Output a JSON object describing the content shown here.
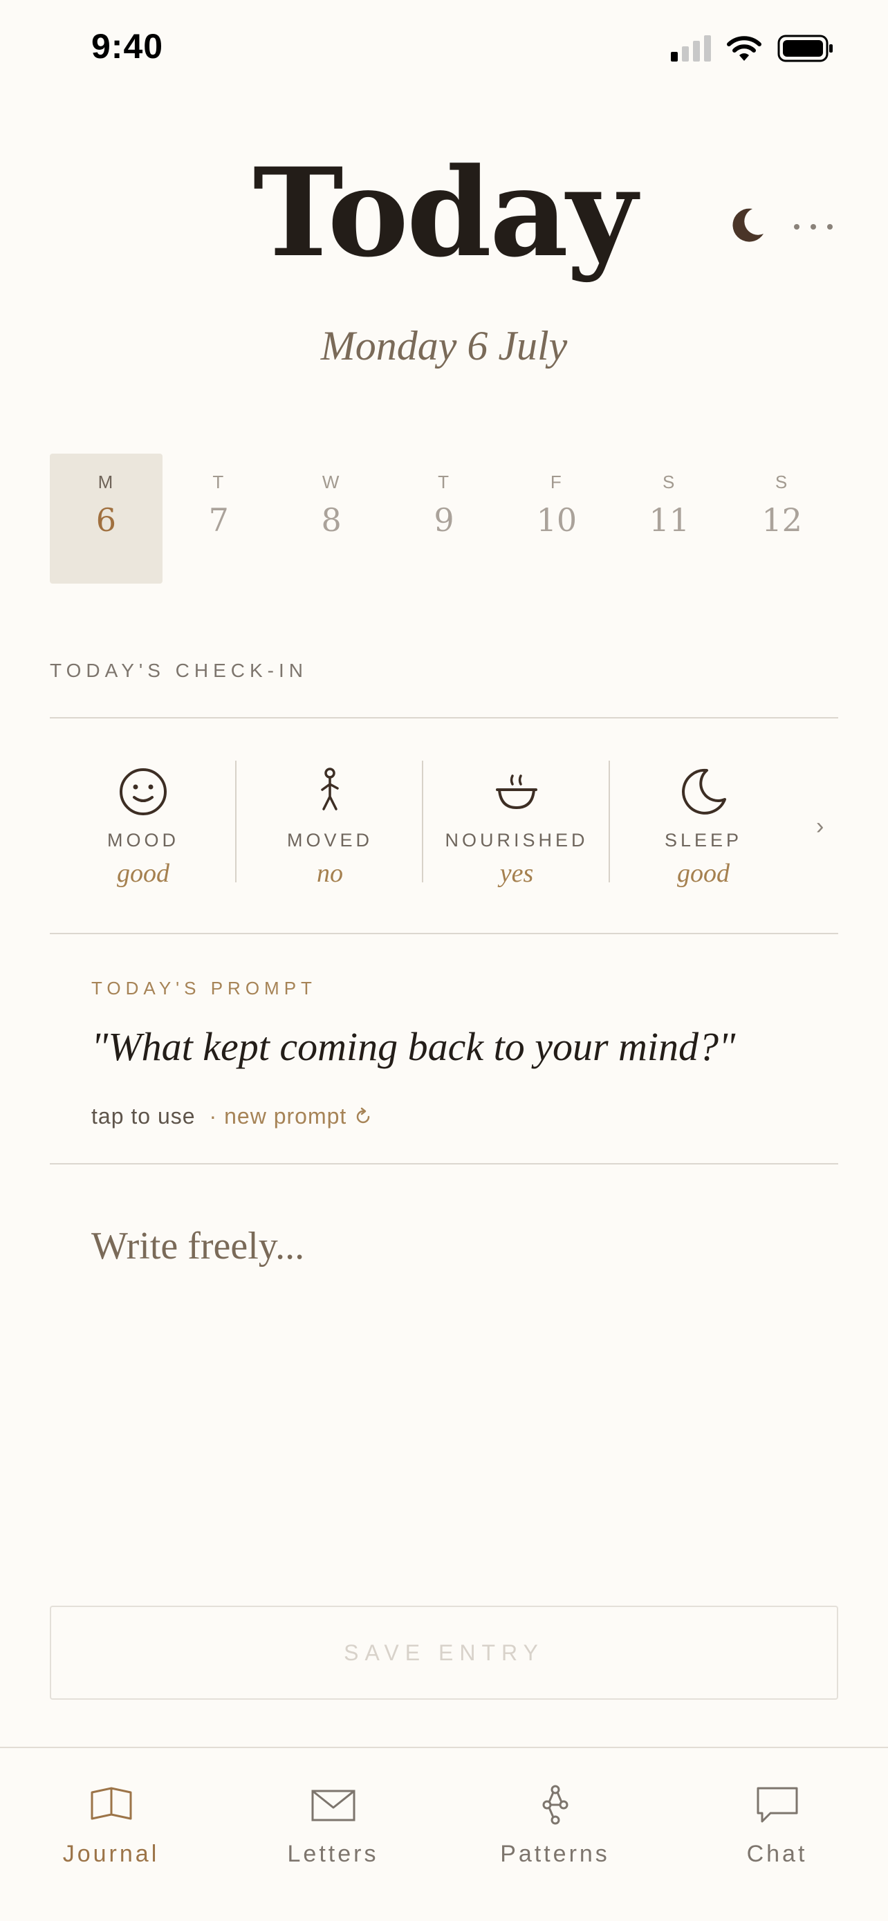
{
  "status_bar": {
    "time": "9:40"
  },
  "header": {
    "title": "Today",
    "date": "Monday 6 July"
  },
  "week": [
    {
      "dow": "M",
      "num": "6",
      "selected": true
    },
    {
      "dow": "T",
      "num": "7"
    },
    {
      "dow": "W",
      "num": "8"
    },
    {
      "dow": "T",
      "num": "9"
    },
    {
      "dow": "F",
      "num": "10"
    },
    {
      "dow": "S",
      "num": "11"
    },
    {
      "dow": "S",
      "num": "12"
    }
  ],
  "checkin": {
    "section_label": "TODAY'S CHECK-IN",
    "items": [
      {
        "label": "MOOD",
        "value": "good",
        "icon": "smile-icon"
      },
      {
        "label": "MOVED",
        "value": "no",
        "icon": "walking-figure-icon"
      },
      {
        "label": "NOURISHED",
        "value": "yes",
        "icon": "steaming-bowl-icon"
      },
      {
        "label": "SLEEP",
        "value": "good",
        "icon": "moon-icon"
      }
    ],
    "more": "›"
  },
  "prompt": {
    "label": "TODAY'S PROMPT",
    "text": "\"What kept coming back to your mind?\"",
    "tap_to_use": "tap to use",
    "new_prompt": "· new prompt"
  },
  "editor": {
    "placeholder": "Write freely..."
  },
  "save_button": {
    "label": "SAVE ENTRY"
  },
  "tabs": [
    {
      "label": "Journal",
      "icon": "open-book-icon",
      "active": true
    },
    {
      "label": "Letters",
      "icon": "envelope-icon"
    },
    {
      "label": "Patterns",
      "icon": "connected-nodes-icon"
    },
    {
      "label": "Chat",
      "icon": "speech-bubble-icon"
    }
  ],
  "colors": {
    "background": "#fdfbf7",
    "accent": "#a68356",
    "ink": "#231d18",
    "selected_day_bg": "#ebe6dc"
  }
}
